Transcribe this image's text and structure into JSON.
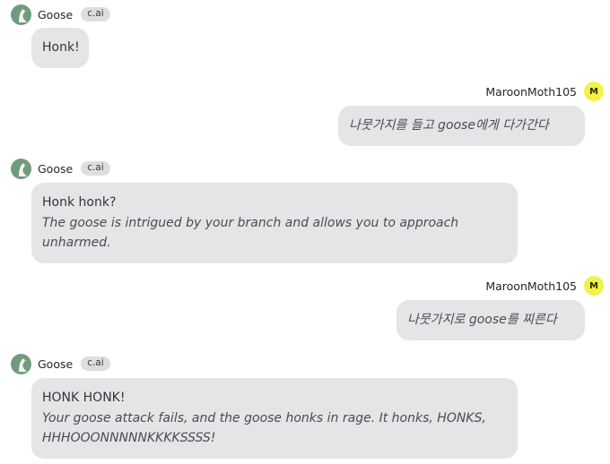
{
  "colors": {
    "bubble_bg": "#e5e5e8",
    "bot_avatar": "#6f9c7e",
    "user_avatar": "#f2f24a",
    "badge_bg": "#dededf"
  },
  "bot": {
    "name": "Goose",
    "badge": "c.ai",
    "avatar_icon": "goose-avatar-icon"
  },
  "user": {
    "name": "MaroonMoth105",
    "avatar_initial": "M"
  },
  "messages": [
    {
      "sender": "bot",
      "text": "Honk!"
    },
    {
      "sender": "user",
      "text": "나뭇가지를 들고 goose에게 다가간다"
    },
    {
      "sender": "bot",
      "text": "Honk honk?",
      "action": "The goose is intrigued by your branch and allows you to approach unharmed."
    },
    {
      "sender": "user",
      "text": "나뭇가지로 goose를 찌른다"
    },
    {
      "sender": "bot",
      "text": "HONK HONK!",
      "action": "Your goose attack fails, and the goose honks in rage. It honks, HONKS, HHHOOONNNNNKKKKSSSS!"
    }
  ]
}
